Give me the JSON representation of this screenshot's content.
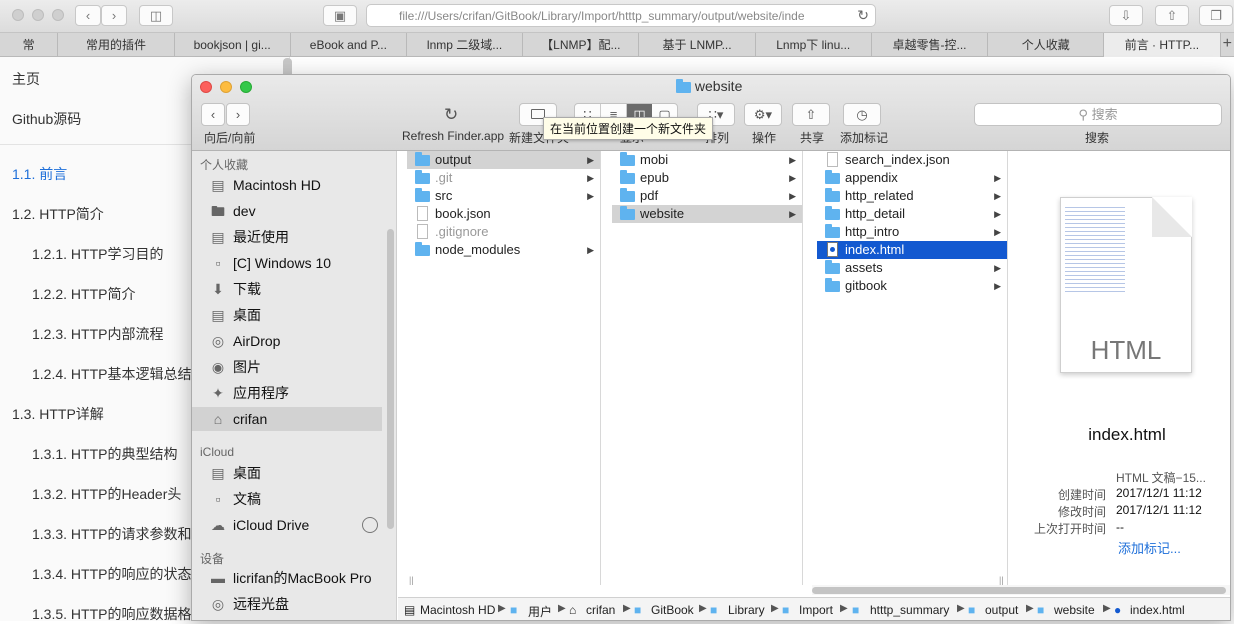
{
  "safari": {
    "url": "file:///Users/crifan/GitBook/Library/Import/htttp_summary/output/website/inde",
    "tabs": [
      "常",
      "常用的插件",
      "bookjson | gi...",
      "eBook and P...",
      "lnmp 二级域...",
      "【LNMP】配...",
      "基于 LNMP...",
      "Lnmp下 linu...",
      "卓越零售-控...",
      "个人收藏",
      "前言 · HTTP..."
    ],
    "icons": [
      "back-icon",
      "forward-icon",
      "sidebar-icon",
      "reader-icon",
      "reload-icon",
      "download-icon",
      "share-icon",
      "tabs-icon"
    ]
  },
  "pagenav": {
    "items": [
      "主页",
      "Github源码",
      "1.1. 前言",
      "1.2. HTTP简介",
      "1.2.1. HTTP学习目的",
      "1.2.2. HTTP简介",
      "1.2.3. HTTP内部流程",
      "1.2.4. HTTP基本逻辑总结",
      "1.3. HTTP详解",
      "1.3.1. HTTP的典型结构",
      "1.3.2. HTTP的Header头",
      "1.3.3. HTTP的请求参数和",
      "1.3.4. HTTP的响应的状态",
      "1.3.5. HTTP的响应数据格"
    ]
  },
  "finder": {
    "title": "website",
    "toolbar": {
      "nav_label": "向后/向前",
      "refresh_label": "Refresh Finder.app",
      "newfolder_label": "新建文件夹",
      "view_label": "显示",
      "arrange_label": "排列",
      "action_label": "操作",
      "share_label": "共享",
      "tag_label": "添加标记",
      "search_placeholder": "搜索",
      "search_label": "搜索",
      "tooltip": "在当前位置创建一个新文件夹"
    },
    "sidebar": {
      "favorites_header": "个人收藏",
      "favorites": [
        {
          "label": "Macintosh HD",
          "icon": "disk-icon"
        },
        {
          "label": "dev",
          "icon": "folder-icon"
        },
        {
          "label": "最近使用",
          "icon": "recents-icon"
        },
        {
          "label": "[C] Windows 10",
          "icon": "document-icon"
        },
        {
          "label": "下载",
          "icon": "download-icon"
        },
        {
          "label": "桌面",
          "icon": "desktop-icon"
        },
        {
          "label": "AirDrop",
          "icon": "airdrop-icon"
        },
        {
          "label": "图片",
          "icon": "camera-icon"
        },
        {
          "label": "应用程序",
          "icon": "applications-icon"
        },
        {
          "label": "crifan",
          "icon": "home-icon"
        }
      ],
      "icloud_header": "iCloud",
      "icloud": [
        {
          "label": "桌面",
          "icon": "desktop-icon"
        },
        {
          "label": "文稿",
          "icon": "documents-icon"
        },
        {
          "label": "iCloud Drive",
          "icon": "cloud-icon"
        }
      ],
      "devices_header": "设备",
      "devices": [
        {
          "label": "licrifan的MacBook Pro",
          "icon": "laptop-icon"
        },
        {
          "label": "远程光盘",
          "icon": "disc-icon"
        }
      ]
    },
    "col1": [
      {
        "name": "output",
        "folder": true,
        "arrow": true
      },
      {
        "name": ".git",
        "folder": true,
        "arrow": true
      },
      {
        "name": "src",
        "folder": true,
        "arrow": true
      },
      {
        "name": "book.json",
        "folder": false,
        "arrow": false
      },
      {
        "name": ".gitignore",
        "folder": false,
        "arrow": false
      },
      {
        "name": "node_modules",
        "folder": true,
        "arrow": true
      }
    ],
    "col2": [
      {
        "name": "mobi",
        "folder": true,
        "arrow": true
      },
      {
        "name": "epub",
        "folder": true,
        "arrow": true
      },
      {
        "name": "pdf",
        "folder": true,
        "arrow": true
      },
      {
        "name": "website",
        "folder": true,
        "arrow": true
      }
    ],
    "col3": [
      {
        "name": "search_index.json",
        "folder": false,
        "arrow": false
      },
      {
        "name": "appendix",
        "folder": true,
        "arrow": true
      },
      {
        "name": "http_related",
        "folder": true,
        "arrow": true
      },
      {
        "name": "http_detail",
        "folder": true,
        "arrow": true
      },
      {
        "name": "http_intro",
        "folder": true,
        "arrow": true
      },
      {
        "name": "index.html",
        "folder": false,
        "arrow": false
      },
      {
        "name": "assets",
        "folder": true,
        "arrow": true
      },
      {
        "name": "gitbook",
        "folder": true,
        "arrow": true
      }
    ],
    "preview": {
      "doc_type_badge": "HTML",
      "filename": "index.html",
      "kind": "HTML 文稿−15...",
      "created_key": "创建时间",
      "created": "2017/12/1 11:12",
      "modified_key": "修改时间",
      "modified": "2017/12/1 11:12",
      "opened_key": "上次打开时间",
      "opened": "--",
      "add_tag": "添加标记..."
    },
    "path": [
      "Macintosh HD",
      "用户",
      "crifan",
      "GitBook",
      "Library",
      "Import",
      "htttp_summary",
      "output",
      "website",
      "index.html"
    ]
  },
  "colors": {
    "accent": "#1359d0",
    "folder": "#5fb3ef",
    "link": "#1e6fd9"
  }
}
